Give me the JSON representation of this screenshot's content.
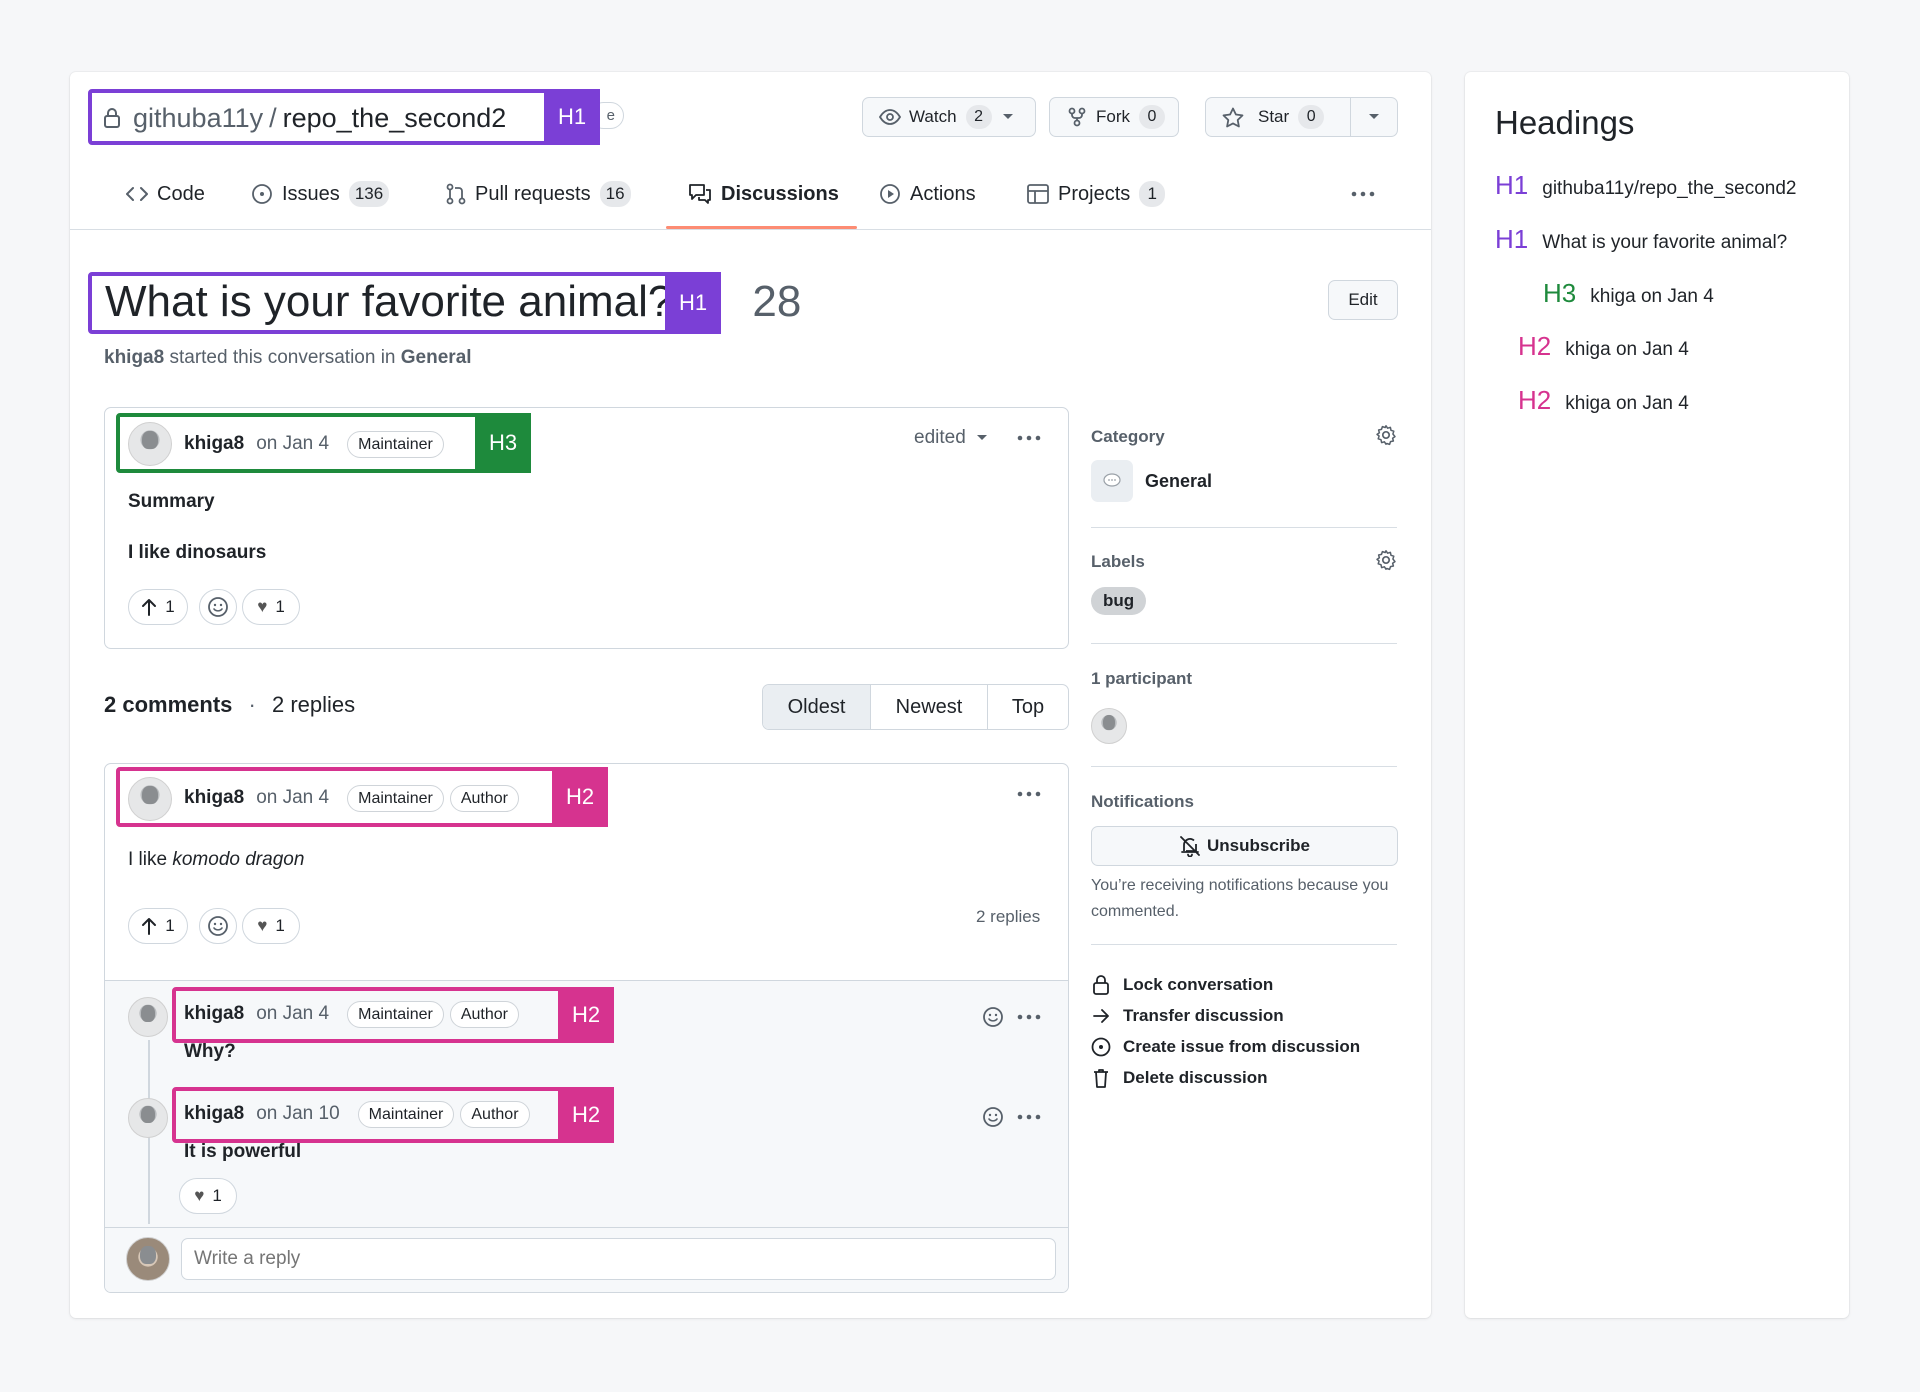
{
  "colors": {
    "h1": "#7b3fd6",
    "h2": "#d6338f",
    "h3": "#1e8a3c",
    "accent": "#fd8c73"
  },
  "header": {
    "owner": "githuba11y",
    "separator": "/",
    "repo": "repo_the_second2",
    "truncated_suffix": "e",
    "watch": {
      "label": "Watch",
      "count": "2"
    },
    "fork": {
      "label": "Fork",
      "count": "0"
    },
    "star": {
      "label": "Star",
      "count": "0"
    }
  },
  "tabs": [
    {
      "label": "Code",
      "icon": "code-icon"
    },
    {
      "label": "Issues",
      "count": "136",
      "icon": "issue-icon"
    },
    {
      "label": "Pull requests",
      "count": "16",
      "icon": "pull-request-icon"
    },
    {
      "label": "Discussions",
      "icon": "discussion-icon",
      "selected": true
    },
    {
      "label": "Actions",
      "icon": "play-icon"
    },
    {
      "label": "Projects",
      "count": "1",
      "icon": "table-icon"
    }
  ],
  "discussion": {
    "title": "What is your favorite animal?",
    "number": "28",
    "edit_label": "Edit",
    "author": "khiga8",
    "started_text": "started this conversation in",
    "category": "General"
  },
  "original_post": {
    "author": "khiga8",
    "date": "on Jan 4",
    "badge": "Maintainer",
    "edited": "edited",
    "summary": "Summary",
    "body": "I like dinosaurs",
    "upvotes": "1",
    "hearts": "1"
  },
  "comments_header": {
    "comments": "2 comments",
    "dot": "·",
    "replies": "2 replies",
    "sort": [
      "Oldest",
      "Newest",
      "Top"
    ]
  },
  "comment": {
    "author": "khiga8",
    "date": "on Jan 4",
    "badges": [
      "Maintainer",
      "Author"
    ],
    "body_prefix": "I like ",
    "body_em": "komodo dragon",
    "upvotes": "1",
    "hearts": "1",
    "reply_count": "2 replies"
  },
  "replies": [
    {
      "author": "khiga8",
      "date": "on Jan 4",
      "badges": [
        "Maintainer",
        "Author"
      ],
      "body": "Why?"
    },
    {
      "author": "khiga8",
      "date": "on Jan 10",
      "badges": [
        "Maintainer",
        "Author"
      ],
      "body": "It is powerful",
      "hearts": "1"
    }
  ],
  "reply_placeholder": "Write a reply",
  "sidebar": {
    "category_title": "Category",
    "category_value": "General",
    "labels_title": "Labels",
    "label": "bug",
    "participants_title": "1 participant",
    "notifications_title": "Notifications",
    "unsubscribe": "Unsubscribe",
    "notif_text": "You’re receiving notifications because you commented.",
    "actions": [
      "Lock conversation",
      "Transfer discussion",
      "Create issue from discussion",
      "Delete discussion"
    ]
  },
  "tags": {
    "h1": "H1",
    "h2": "H2",
    "h3": "H3"
  },
  "headings_panel": {
    "title": "Headings",
    "items": [
      {
        "level": "H1",
        "text": "githuba11y/repo_the_second2"
      },
      {
        "level": "H1",
        "text": "What is your favorite animal?"
      },
      {
        "level": "H3",
        "text": "khiga on Jan 4"
      },
      {
        "level": "H2",
        "text": "khiga on Jan 4"
      },
      {
        "level": "H2",
        "text": "khiga on Jan 4"
      }
    ]
  }
}
